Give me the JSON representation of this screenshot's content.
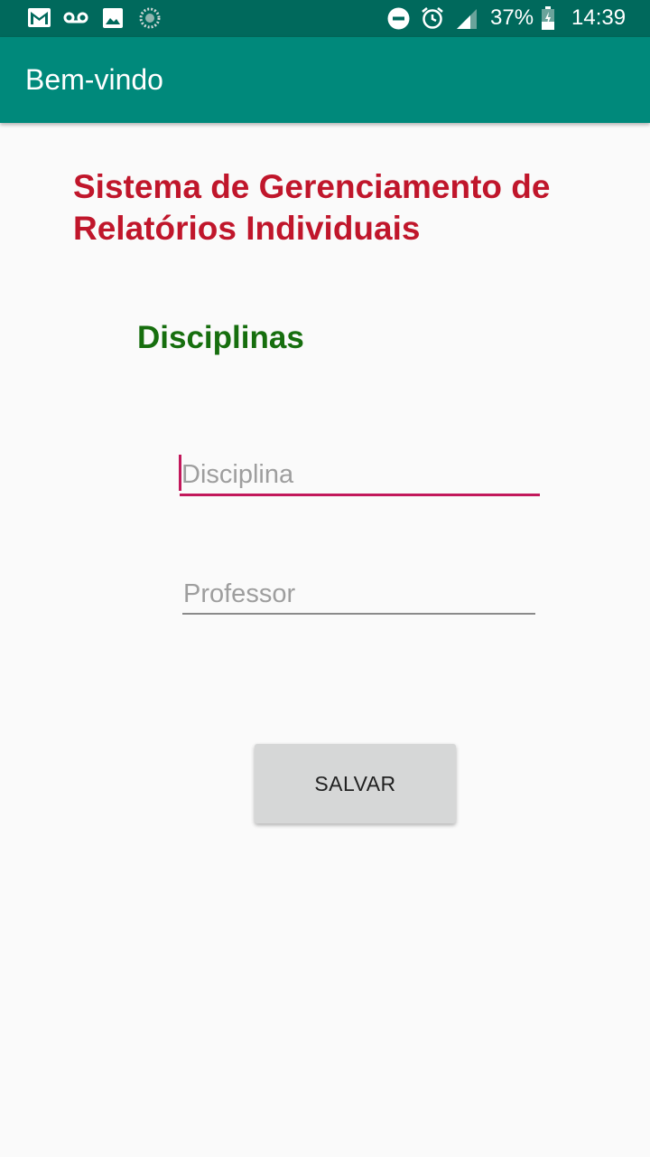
{
  "status_bar": {
    "battery": "37%",
    "time": "14:39",
    "icons": [
      "gmail-icon",
      "voicemail-icon",
      "image-icon",
      "sync-icon",
      "do-not-disturb-icon",
      "alarm-icon",
      "signal-icon",
      "battery-icon"
    ]
  },
  "app_bar": {
    "title": "Bem-vindo"
  },
  "main": {
    "title": "Sistema de Gerenciamento de Relatórios Individuais",
    "section_title": "Disciplinas",
    "discipline_field": {
      "placeholder": "Disciplina",
      "value": ""
    },
    "professor_field": {
      "placeholder": "Professor",
      "value": ""
    },
    "save_label": "SALVAR"
  },
  "colors": {
    "status_bar": "#00695c",
    "app_bar": "#00897b",
    "title": "#c0162b",
    "section_title": "#166e0e",
    "focus_accent": "#c2185b"
  }
}
